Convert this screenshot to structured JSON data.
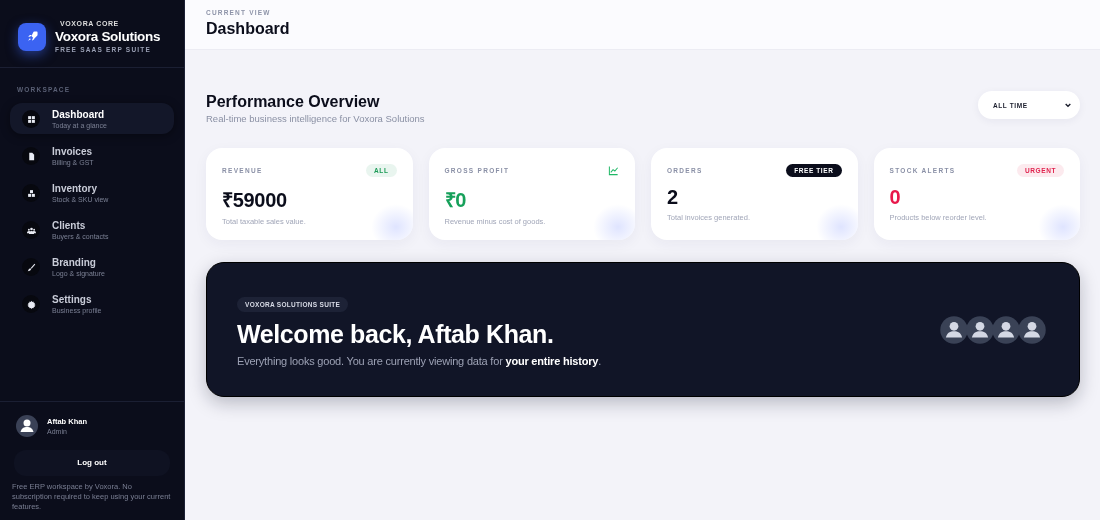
{
  "brand": {
    "eyebrow": "VOXORA CORE",
    "name": "Voxora Solutions",
    "tagline": "FREE SAAS ERP SUITE"
  },
  "sidebar": {
    "section": "WORKSPACE",
    "items": [
      {
        "label": "Dashboard",
        "hint": "Today at a glance",
        "selected": true
      },
      {
        "label": "Invoices",
        "hint": "Billing & GST",
        "selected": false
      },
      {
        "label": "Inventory",
        "hint": "Stock & SKU view",
        "selected": false
      },
      {
        "label": "Clients",
        "hint": "Buyers & contacts",
        "selected": false
      },
      {
        "label": "Branding",
        "hint": "Logo & signature",
        "selected": false
      },
      {
        "label": "Settings",
        "hint": "Business profile",
        "selected": false
      }
    ]
  },
  "user": {
    "name": "Aftab Khan",
    "role": "Admin"
  },
  "logout": "Log out",
  "footer_note": "Free ERP workspace by Voxora. No subscription required to keep using your current features.",
  "header": {
    "eyebrow": "CURRENT VIEW",
    "title": "Dashboard"
  },
  "overview": {
    "title": "Performance Overview",
    "subtitle": "Real-time business intelligence for Voxora Solutions",
    "range": "ALL TIME"
  },
  "cards": [
    {
      "label": "REVENUE",
      "badge": {
        "kind": "tag",
        "color": "#1a9a55",
        "text": "ALL"
      },
      "value": "₹59000",
      "color": "#0b0d1b",
      "note": "Total taxable sales value."
    },
    {
      "label": "GROSS PROFIT",
      "badge": {
        "kind": "icon"
      },
      "value": "₹0",
      "color": "#16a05a",
      "note": "Revenue minus cost of goods."
    },
    {
      "label": "ORDERS",
      "badge": {
        "kind": "tag",
        "color": "#0b0d1b",
        "text": "FREE TIER"
      },
      "value": "2",
      "color": "#0b0d1b",
      "note": "Total invoices generated."
    },
    {
      "label": "STOCK ALERTS",
      "badge": {
        "kind": "tag",
        "color": "#e0234e",
        "text": "URGENT"
      },
      "value": "0",
      "color": "#e8174a",
      "note": "Products below reorder level."
    }
  ],
  "banner": {
    "tag": "VOXORA SOLUTIONS SUITE",
    "title": "Welcome back, Aftab Khan.",
    "text": "Everything looks good. You are currently viewing data for **your entire history**.",
    "avatars": [
      {
        "kind": "person"
      },
      {
        "kind": "person"
      },
      {
        "kind": "person"
      },
      {
        "kind": "person"
      }
    ]
  }
}
